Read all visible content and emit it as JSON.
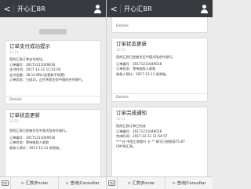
{
  "topbar": {
    "back_glyph": "<",
    "title": "开心汇BR",
    "profile_icon": "person-icon"
  },
  "left": {
    "stamp": "",
    "card1": {
      "title": "订单支付成功提示",
      "date": "12-11",
      "lines": [
        "您的汇款订单支付成功。",
        "订单编号：2017121104901​6",
        "支付时间：2017-12-11 11:52:04",
        "支付金额：38.14 BRL(含税和手续费)",
        "订单状态：已成功，正在将资金交中国的合作银行。"
      ],
      "details": "Details"
    },
    "card2": {
      "title": "订单状态更新",
      "date": "12-11",
      "lines": [
        "您的汇款已经被交至中国大陆合作银行。",
        "订单编号：2017121104901​6",
        "订单状态：等待收款人收款",
        "收款人预计：2017-12-11 前到账。"
      ]
    }
  },
  "right": {
    "stub_details": "Details",
    "card1": {
      "title": "订单状态更新",
      "date": "12-11",
      "lines": [
        "您的汇款已经被交至中国大陆合作银行。",
        "订单编号：2017121104901​6",
        "订单状态：等待收款人收款",
        "收款人预计：2017-12-11 前到账。"
      ],
      "details": "Details"
    },
    "card2": {
      "title": "订单完成通知",
      "date": "12-11",
      "lines": [
        "您的汇款订单已完成",
        "订单编号：2017121104901​6",
        "完成时间：2017-12-11 11:54:57",
        "*** 在 中国工商银行 卡 ** 尾号已经收款75.87",
        "CNY的汇款。"
      ]
    }
  },
  "bottombar": {
    "menu1": "汇款|Enviar",
    "menu2": "查询|Consultar",
    "menu_glyph": "≡"
  }
}
